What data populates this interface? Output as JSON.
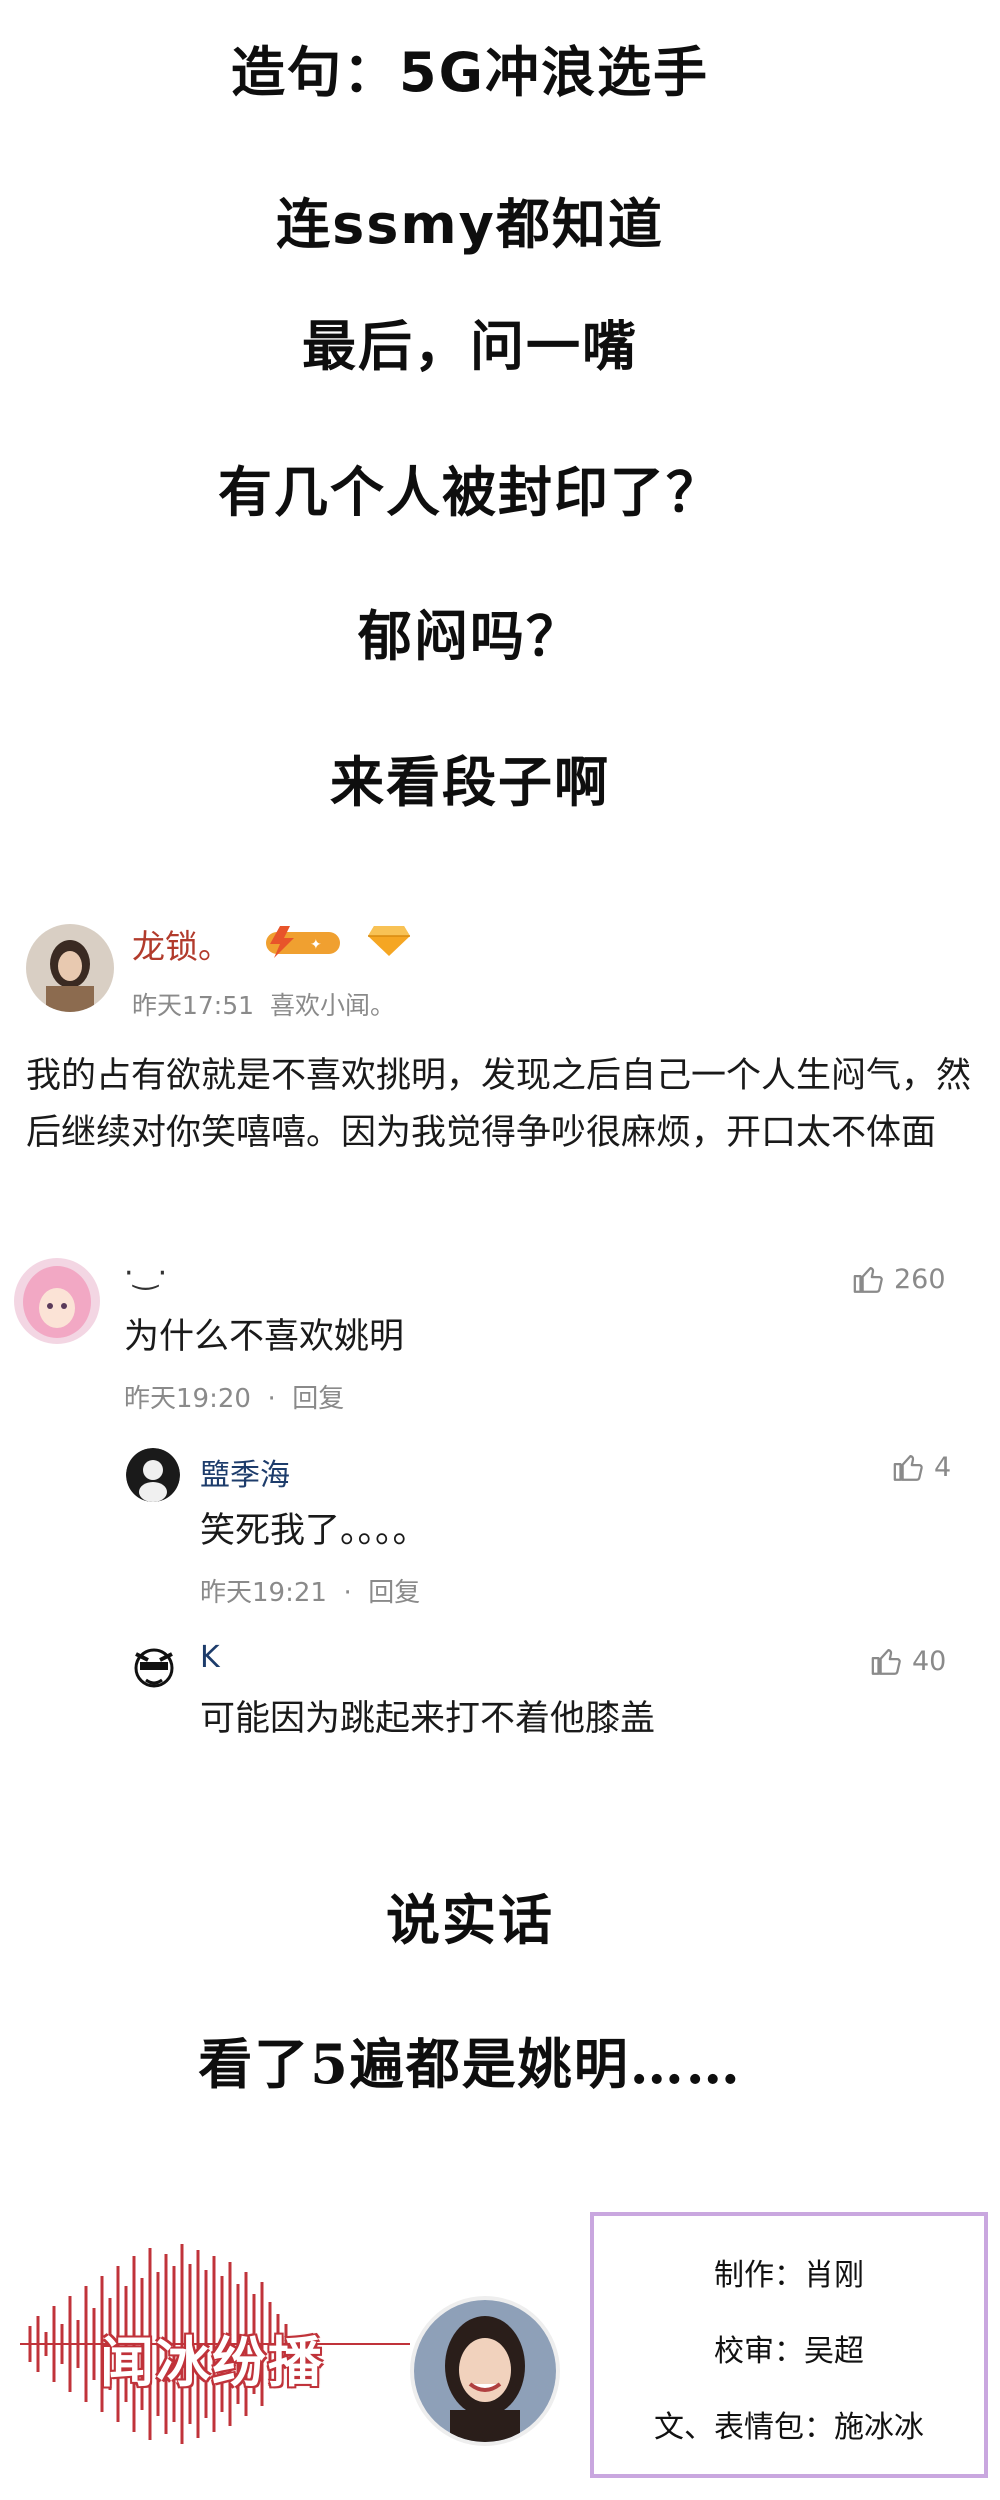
{
  "captions": {
    "line1": "造句：5G冲浪选手",
    "line2": "连ssmy都知道",
    "line3": "最后，问一嘴",
    "line4": "有几个人被封印了？",
    "line5": "郁闷吗？",
    "line6": "来看段子啊",
    "line7": "说实话",
    "line8": "看了5遍都是姚明……"
  },
  "post": {
    "username": "龙锁。",
    "time": "昨天17:51",
    "source": "喜欢小闻。",
    "body": "我的占有欲就是不喜欢挑明，发现之后自己一个人生闷气，然后继续对你笑嘻嘻。因为我觉得争吵很麻烦，开口太不体面",
    "badge_icon": "lightning-badge-icon",
    "vip_icon": "diamond-icon"
  },
  "comments": [
    {
      "username": "·‿·",
      "text": "为什么不喜欢姚明",
      "time": "昨天19:20",
      "reply_label": "回复",
      "likes": "260"
    },
    {
      "username": "盬季海",
      "text": "笑死我了。。。。",
      "time": "昨天19:21",
      "reply_label": "回复",
      "likes": "4"
    },
    {
      "username": "K",
      "text": "可能因为跳起来打不着他膝盖",
      "likes": "40"
    }
  ],
  "brand": {
    "logo_text": "闻冰纷播"
  },
  "credits": {
    "producer": "制作：肖刚",
    "reviewer": "校审：吴超",
    "writer": "文、表情包：施冰冰"
  },
  "colors": {
    "username_red": "#b23b2c",
    "comment_name_blue": "#1d3c6b",
    "meta_gray": "#8a8a8a",
    "credit_border": "#c9a7df",
    "waveform_red": "#c0333a"
  }
}
